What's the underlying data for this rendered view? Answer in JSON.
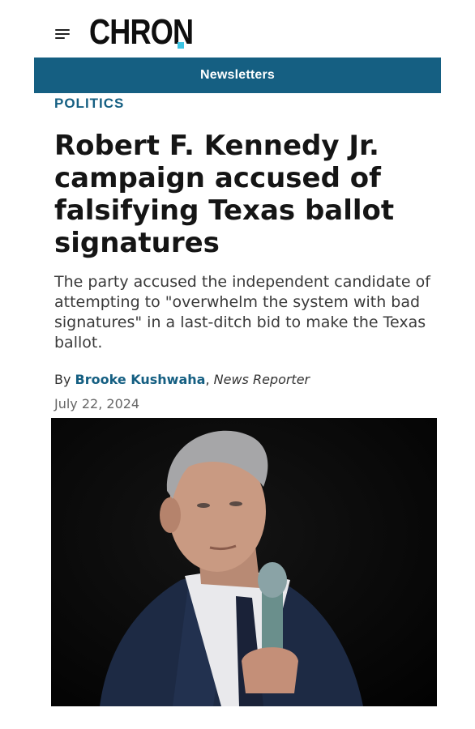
{
  "header": {
    "menu_icon": "hamburger-menu-icon",
    "logo_text": "CHRON",
    "logo_accent_color": "#3cc4e3"
  },
  "newsletter_bar": {
    "label": "Newsletters",
    "background_color": "#155f82"
  },
  "article": {
    "section": "POLITICS",
    "headline": "Robert F. Kennedy Jr. campaign accused of falsifying Texas ballot signatures",
    "dek": "The party accused the independent candidate of attempting to \"overwhelm the system with bad signatures\" in a last-ditch bid to make the Texas ballot.",
    "byline": {
      "prefix": "By",
      "author": "Brooke Kushwaha",
      "separator": ",",
      "role": "News Reporter"
    },
    "date": "July 22, 2024",
    "accent_color": "#155f82"
  }
}
